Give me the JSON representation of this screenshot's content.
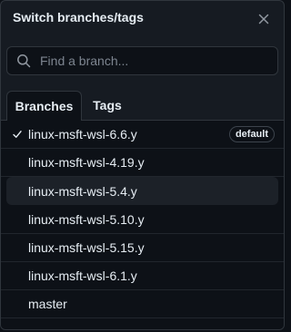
{
  "header": {
    "title": "Switch branches/tags",
    "close_icon": "close-icon"
  },
  "search": {
    "placeholder": "Find a branch...",
    "value": "",
    "icon": "search-icon"
  },
  "tabs": [
    {
      "label": "Branches",
      "selected": true
    },
    {
      "label": "Tags",
      "selected": false
    }
  ],
  "branches": [
    {
      "name": "linux-msft-wsl-6.6.y",
      "checked": true,
      "badge": "default"
    },
    {
      "name": "linux-msft-wsl-4.19.y",
      "checked": false,
      "badge": ""
    },
    {
      "name": "linux-msft-wsl-5.4.y",
      "checked": false,
      "badge": "",
      "hovered": true
    },
    {
      "name": "linux-msft-wsl-5.10.y",
      "checked": false,
      "badge": ""
    },
    {
      "name": "linux-msft-wsl-5.15.y",
      "checked": false,
      "badge": ""
    },
    {
      "name": "linux-msft-wsl-6.1.y",
      "checked": false,
      "badge": ""
    },
    {
      "name": "master",
      "checked": false,
      "badge": ""
    }
  ],
  "colors": {
    "panel_bg": "#161b22",
    "list_bg": "#0d1117",
    "border": "#30363d",
    "text": "#e6edf3",
    "muted": "#7d8590"
  }
}
